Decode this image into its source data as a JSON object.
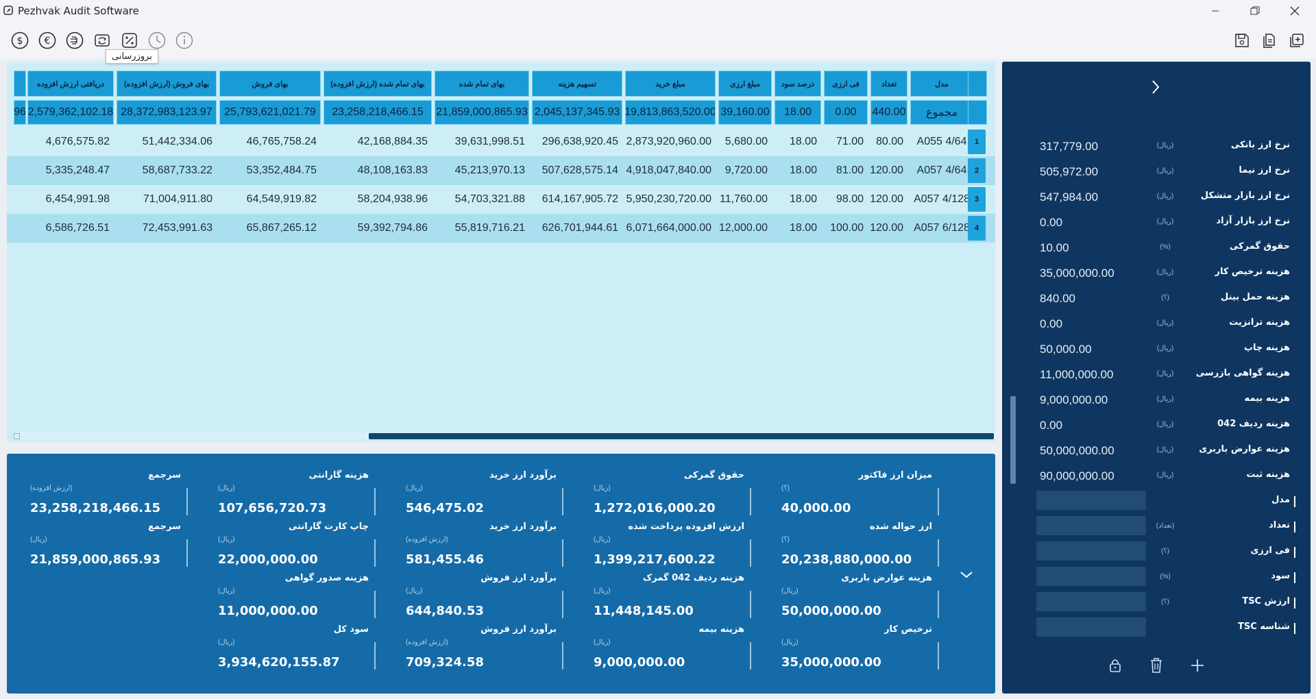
{
  "window": {
    "title": "Pezhvak Audit Software"
  },
  "toolbar": {
    "left_icons": [
      "dollar-icon",
      "euro-icon",
      "dirham-icon",
      "refresh-icon",
      "percent-icon",
      "clock-icon",
      "info-icon"
    ],
    "right_icons": [
      "save-icon",
      "copy-icon",
      "new-tab-icon"
    ],
    "tooltip": "بروزرسانی"
  },
  "grid": {
    "headers": [
      "دریافتی ارزش افزوده",
      "بهای فروش (ارزش افزوده)",
      "بهای فروش",
      "بهای تمام شده (ارزش افزوده)",
      "بهای تمام شده",
      "تسهیم هزینه",
      "مبلغ خرید",
      "مبلغ ارزی",
      "درصد سود",
      "فی ارزی",
      "تعداد",
      "مدل"
    ],
    "totals": {
      "first_partial": "96",
      "values": [
        "2,579,362,102.18",
        "28,372,983,123.97",
        "25,793,621,021.79",
        "23,258,218,466.15",
        "21,859,000,865.93",
        "2,045,137,345.93",
        "19,813,863,520.00",
        "39,160.00",
        "18.00",
        "0.00",
        "440.00",
        "مجموع"
      ]
    },
    "rows": [
      {
        "num": "1",
        "cells": [
          "4,676,575.82",
          "51,442,334.06",
          "46,765,758.24",
          "42,168,884.35",
          "39,631,998.51",
          "296,638,920.45",
          "2,873,920,960.00",
          "5,680.00",
          "18.00",
          "71.00",
          "80.00",
          "A055 4/64"
        ]
      },
      {
        "num": "2",
        "cells": [
          "5,335,248.47",
          "58,687,733.22",
          "53,352,484.75",
          "48,108,163.83",
          "45,213,970.13",
          "507,628,575.14",
          "4,918,047,840.00",
          "9,720.00",
          "18.00",
          "81.00",
          "120.00",
          "A057 4/64"
        ]
      },
      {
        "num": "3",
        "cells": [
          "6,454,991.98",
          "71,004,911.80",
          "64,549,919.82",
          "58,204,938.96",
          "54,703,321.88",
          "614,167,905.72",
          "5,950,230,720.00",
          "11,760.00",
          "18.00",
          "98.00",
          "120.00",
          "A057 4/128"
        ]
      },
      {
        "num": "4",
        "cells": [
          "6,586,726.51",
          "72,453,991.63",
          "65,867,265.12",
          "59,392,794.86",
          "55,819,716.21",
          "626,701,944.61",
          "6,071,664,000.00",
          "12,000.00",
          "18.00",
          "100.00",
          "120.00",
          "A057 6/128"
        ]
      }
    ]
  },
  "summary": {
    "items": [
      {
        "label": "میزان ارز فاکتور",
        "unit": "(؟)",
        "value": "40,000.00"
      },
      {
        "label": "حقوق گمرکی",
        "unit": "(ریال)",
        "value": "1,272,016,000.20"
      },
      {
        "label": "برآورد ارز خرید",
        "unit": "(ریال)",
        "value": "546,475.02"
      },
      {
        "label": "هزینه گارانتی",
        "unit": "(ریال)",
        "value": "107,656,720.73"
      },
      {
        "label": "سرجمع",
        "unit": "(ارزش افزوده)",
        "value": "23,258,218,466.15"
      },
      {
        "label": "ارز حواله شده",
        "unit": "(؟)",
        "value": "20,238,880,000.00"
      },
      {
        "label": "ارزش افزوده پرداخت شده",
        "unit": "(ریال)",
        "value": "1,399,217,600.22"
      },
      {
        "label": "برآورد ارز خرید",
        "unit": "(ارزش افزوده)",
        "value": "581,455.46"
      },
      {
        "label": "چاپ کارت گارانتی",
        "unit": "(ریال)",
        "value": "22,000,000.00"
      },
      {
        "label": "سرجمع",
        "unit": "(ریال)",
        "value": "21,859,000,865.93"
      },
      {
        "label": "هزینه عوارض باربری",
        "unit": "(ریال)",
        "value": "50,000,000.00"
      },
      {
        "label": "هزینه ردیف 042 گمرک",
        "unit": "(ریال)",
        "value": "11,448,145.00"
      },
      {
        "label": "برآورد ارز فروش",
        "unit": "(ریال)",
        "value": "644,840.53"
      },
      {
        "label": "هزینه صدور گواهی",
        "unit": "(ریال)",
        "value": "11,000,000.00"
      },
      {
        "label": "ترخیص کار",
        "unit": "(ریال)",
        "value": "35,000,000.00"
      },
      {
        "label": "هزینه بیمه",
        "unit": "(ریال)",
        "value": "9,000,000.00"
      },
      {
        "label": "برآورد ارز فروش",
        "unit": "(ارزش افزوده)",
        "value": "709,324.58"
      },
      {
        "label": "سود کل",
        "unit": "(ریال)",
        "value": "3,934,620,155.87"
      }
    ]
  },
  "params": {
    "rows": [
      {
        "label": "نرخ ارز بانکی",
        "unit": "(ریال)",
        "value": "317,779.00"
      },
      {
        "label": "نرخ ارز نیما",
        "unit": "(ریال)",
        "value": "505,972.00"
      },
      {
        "label": "نرخ ارز بازار متشکل",
        "unit": "(ریال)",
        "value": "547,984.00"
      },
      {
        "label": "نرخ ارز بازار آزاد",
        "unit": "(ریال)",
        "value": "0.00"
      },
      {
        "label": "حقوق گمرکی",
        "unit": "(%)",
        "value": "10.00"
      },
      {
        "label": "هزینه ترخیص کار",
        "unit": "(ریال)",
        "value": "35,000,000.00"
      },
      {
        "label": "هزینه حمل بینل",
        "unit": "(؟)",
        "value": "840.00"
      },
      {
        "label": "هزینه ترانزیت",
        "unit": "(ریال)",
        "value": "0.00"
      },
      {
        "label": "هزینه چاپ",
        "unit": "(ریال)",
        "value": "50,000.00"
      },
      {
        "label": "هزینه گواهی بازرسی",
        "unit": "(ریال)",
        "value": "11,000,000.00"
      },
      {
        "label": "هزینه بیمه",
        "unit": "(ریال)",
        "value": "9,000,000.00"
      },
      {
        "label": "هزینه ردیف 042",
        "unit": "(ریال)",
        "value": "0.00"
      },
      {
        "label": "هزینه عوارض باربری",
        "unit": "(ریال)",
        "value": "50,000,000.00"
      },
      {
        "label": "هزینه ثبت",
        "unit": "(ریال)",
        "value": "90,000,000.00"
      }
    ],
    "inputs": [
      {
        "label": "مدل",
        "unit": ""
      },
      {
        "label": "تعداد",
        "unit": "(تعداد)"
      },
      {
        "label": "فی ارزی",
        "unit": "(؟)"
      },
      {
        "label": "سود",
        "unit": "(%)"
      },
      {
        "label": "ارزش TSC",
        "unit": "(؟)"
      },
      {
        "label": "شناسه TSC",
        "unit": ""
      }
    ],
    "action_icons": [
      "lock-icon",
      "trash-icon",
      "plus-icon"
    ]
  }
}
